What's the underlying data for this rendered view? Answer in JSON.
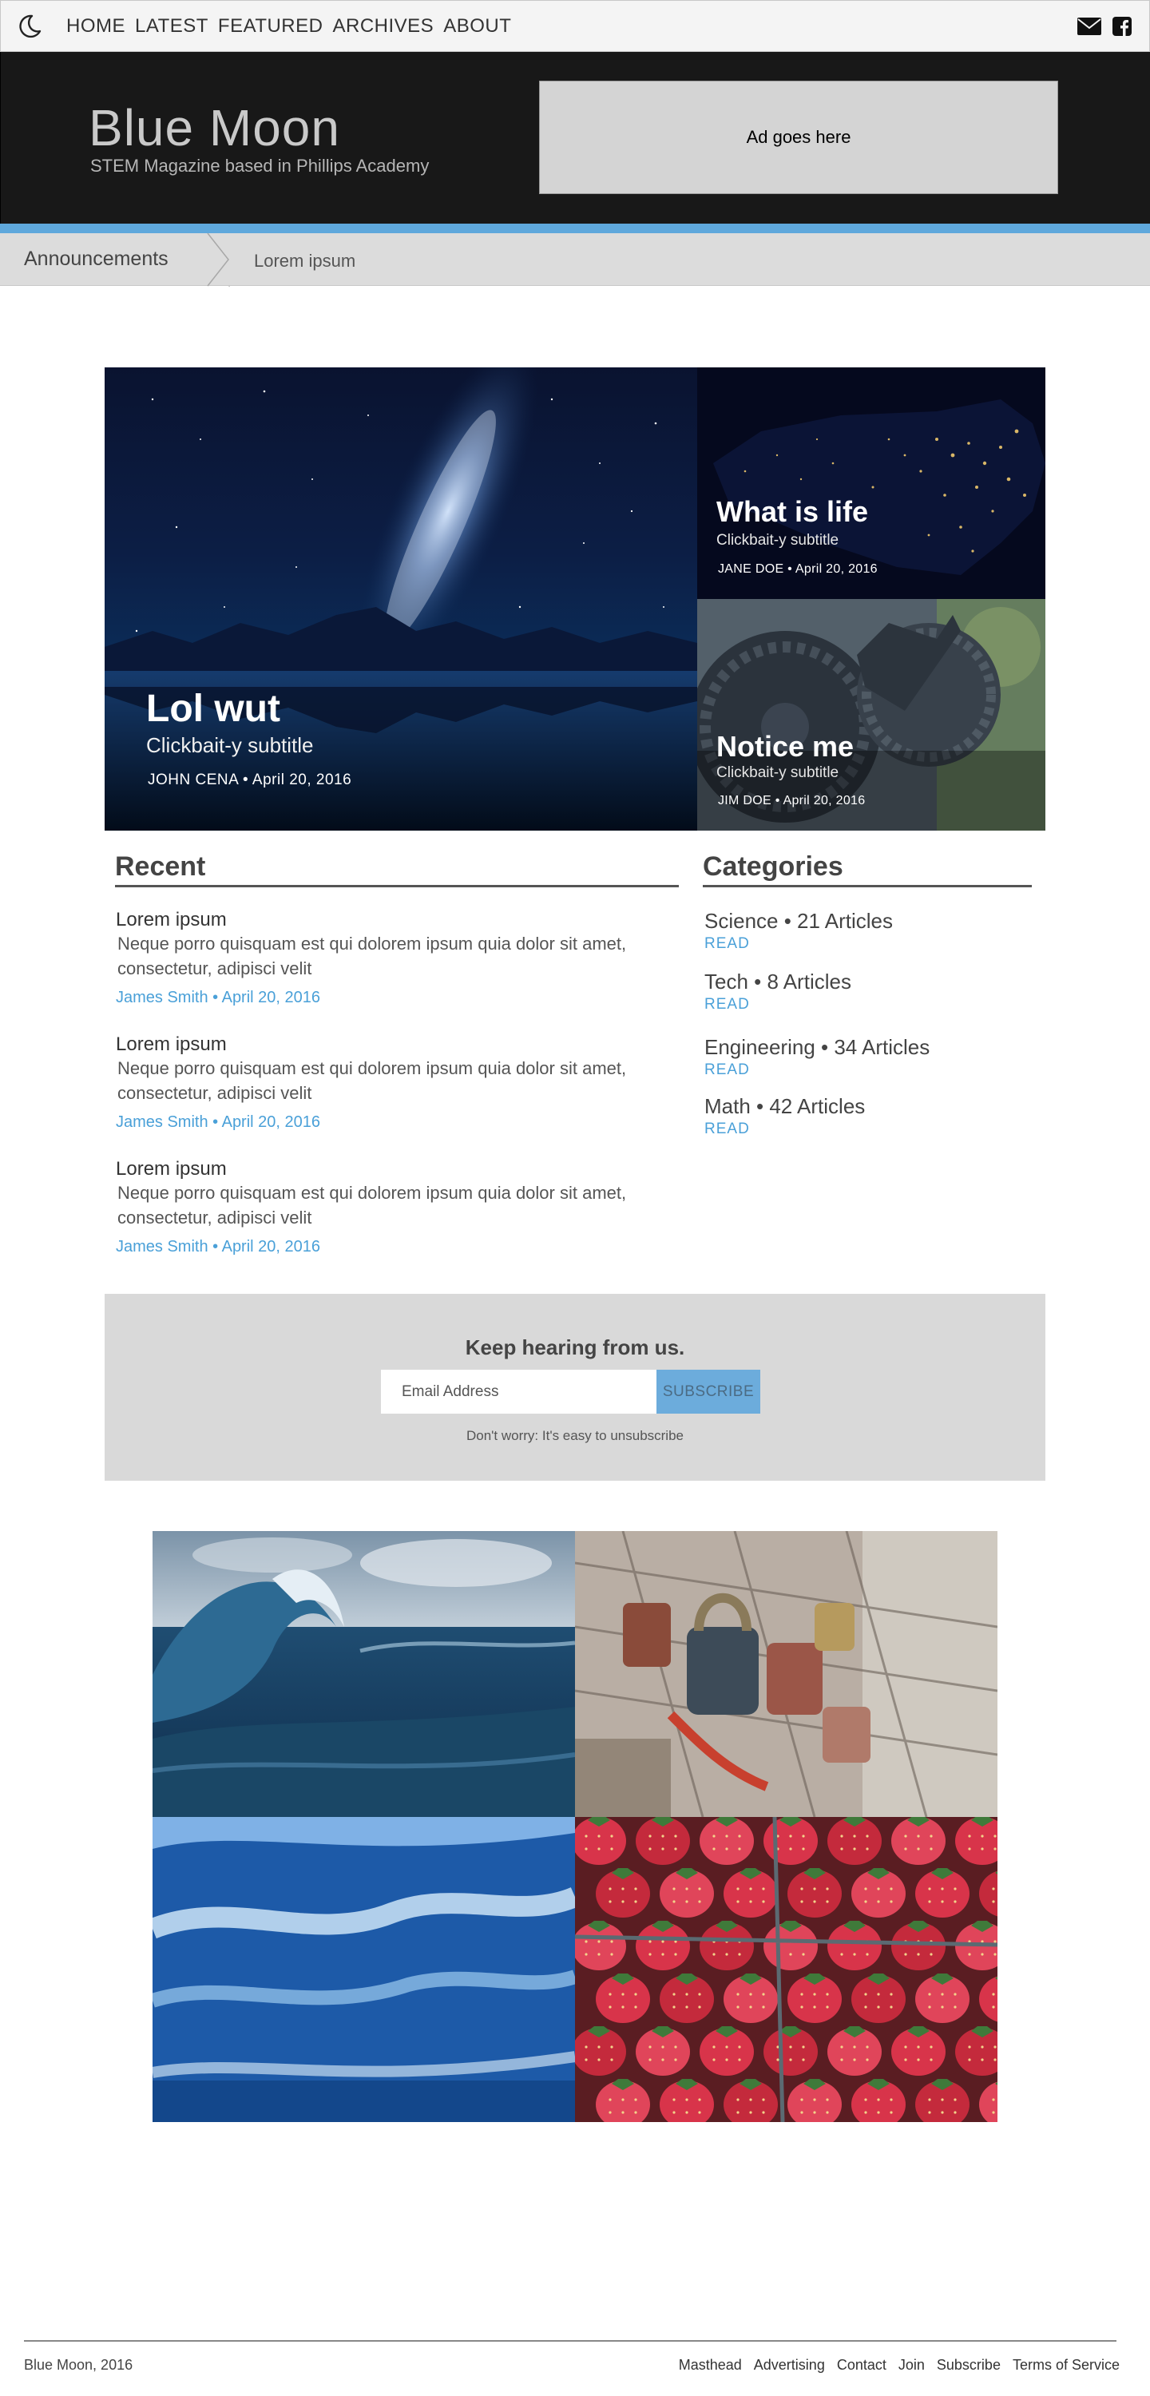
{
  "nav": {
    "items": [
      "HOME",
      "LATEST",
      "FEATURED",
      "ARCHIVES",
      "ABOUT"
    ],
    "icons": {
      "theme": "moon-icon",
      "mail": "envelope-icon",
      "facebook": "facebook-icon"
    }
  },
  "header": {
    "brand": "Blue Moon",
    "tagline": "STEM Magazine based in Phillips Academy",
    "ad_text": "Ad goes here",
    "accent_color": "#5fa8dc"
  },
  "announcements": {
    "label": "Announcements",
    "text": "Lorem ipsum"
  },
  "hero": {
    "main": {
      "title": "Lol wut",
      "subtitle": "Clickbait-y subtitle",
      "meta": "JOHN CENA • April 20, 2016"
    },
    "side": [
      {
        "title": "What is life",
        "subtitle": "Clickbait-y subtitle",
        "meta": "JANE DOE • April 20, 2016"
      },
      {
        "title": "Notice me",
        "subtitle": "Clickbait-y subtitle",
        "meta": "JIM DOE • April 20, 2016"
      }
    ]
  },
  "recent": {
    "heading": "Recent",
    "articles": [
      {
        "title": "Lorem ipsum",
        "body_line1": "Neque porro quisquam est qui dolorem ipsum quia dolor sit amet,",
        "body_line2": "consectetur, adipisci velit",
        "meta": "James Smith • April 20, 2016"
      },
      {
        "title": "Lorem ipsum",
        "body_line1": "Neque porro quisquam est qui dolorem ipsum quia dolor sit amet,",
        "body_line2": "consectetur, adipisci velit",
        "meta": "James Smith • April 20, 2016"
      },
      {
        "title": "Lorem ipsum",
        "body_line1": "Neque porro quisquam est qui dolorem ipsum quia dolor sit amet,",
        "body_line2": "consectetur, adipisci velit",
        "meta": "James Smith • April 20, 2016"
      }
    ]
  },
  "categories": {
    "heading": "Categories",
    "items": [
      {
        "label": "Science • 21 Articles",
        "action": "READ"
      },
      {
        "label": "Tech • 8 Articles",
        "action": "READ"
      },
      {
        "label": "Engineering • 34 Articles",
        "action": "READ"
      },
      {
        "label": "Math • 42 Articles",
        "action": "READ"
      }
    ]
  },
  "newsletter": {
    "title": "Keep hearing from us.",
    "placeholder": "Email Address",
    "button": "SUBSCRIBE",
    "note": "Don't worry: It's easy to unsubscribe"
  },
  "footer": {
    "copyright": "Blue Moon, 2016",
    "links": [
      "Masthead",
      "Advertising",
      "Contact",
      "Join",
      "Subscribe",
      "Terms of Service"
    ]
  },
  "colors": {
    "link_blue": "#4aa0d8",
    "header_bg": "#181818",
    "button_blue": "#6cacdc"
  }
}
